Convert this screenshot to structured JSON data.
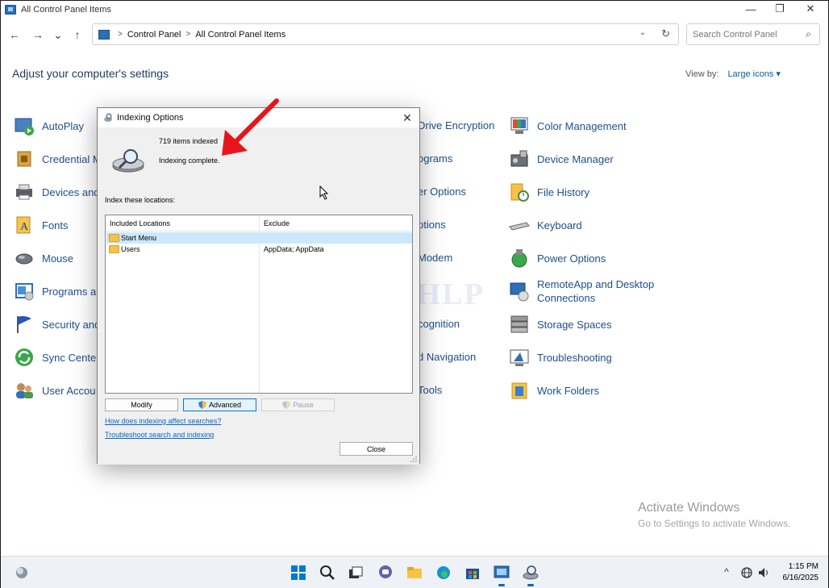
{
  "window": {
    "title": "All Control Panel Items",
    "minimize": "—",
    "restore": "❐",
    "close": "✕"
  },
  "nav": {
    "back": "←",
    "forward": "→",
    "recent": "⌄",
    "up": "↑"
  },
  "address": {
    "crumbs": [
      "Control Panel",
      "All Control Panel Items"
    ],
    "separator": ">",
    "dropdown": "⌄",
    "refresh": "↻"
  },
  "search": {
    "placeholder": "Search Control Panel",
    "icon": "⌕"
  },
  "page": {
    "heading": "Adjust your computer's settings",
    "view_by_label": "View by:",
    "view_by_value": "Large icons ▾"
  },
  "items": {
    "col1": [
      "AutoPlay",
      "Credential M",
      "Devices and",
      "Fonts",
      "Mouse",
      "Programs ar",
      "Security and",
      "Sync Center",
      "User Accou"
    ],
    "col2": [
      "Drive Encryption",
      "ograms",
      "er Options",
      "ptions",
      "Modem",
      "",
      "cognition",
      "d Navigation",
      "Tools"
    ],
    "col3": [
      "Color Management",
      "Device Manager",
      "File History",
      "Keyboard",
      "Power Options",
      "RemoteApp and Desktop Connections",
      "Storage Spaces",
      "Troubleshooting",
      "Work Folders"
    ]
  },
  "dialog": {
    "title": "Indexing Options",
    "close": "✕",
    "items_indexed": "719 items indexed",
    "status": "Indexing complete.",
    "locations_label": "Index these locations:",
    "columns": [
      "Included Locations",
      "Exclude"
    ],
    "rows": [
      {
        "location": "Start Menu",
        "exclude": ""
      },
      {
        "location": "Users",
        "exclude": "AppData; AppData"
      }
    ],
    "buttons": {
      "modify": "Modify",
      "advanced": "Advanced",
      "pause": "Pause",
      "close": "Close"
    },
    "links": {
      "how": "How does indexing affect searches?",
      "troubleshoot": "Troubleshoot search and indexing"
    }
  },
  "watermark": "IT Pros HLP",
  "activation": {
    "title": "Activate Windows",
    "subtitle": "Go to Settings to activate Windows."
  },
  "taskbar": {
    "tray_chevron": "^",
    "time": "1:15 PM",
    "date": "6/16/2025"
  },
  "colors": {
    "accent": "#0067c0",
    "link": "#0066cc",
    "item_text": "#1f4f8a",
    "arrow": "#e8141b"
  }
}
